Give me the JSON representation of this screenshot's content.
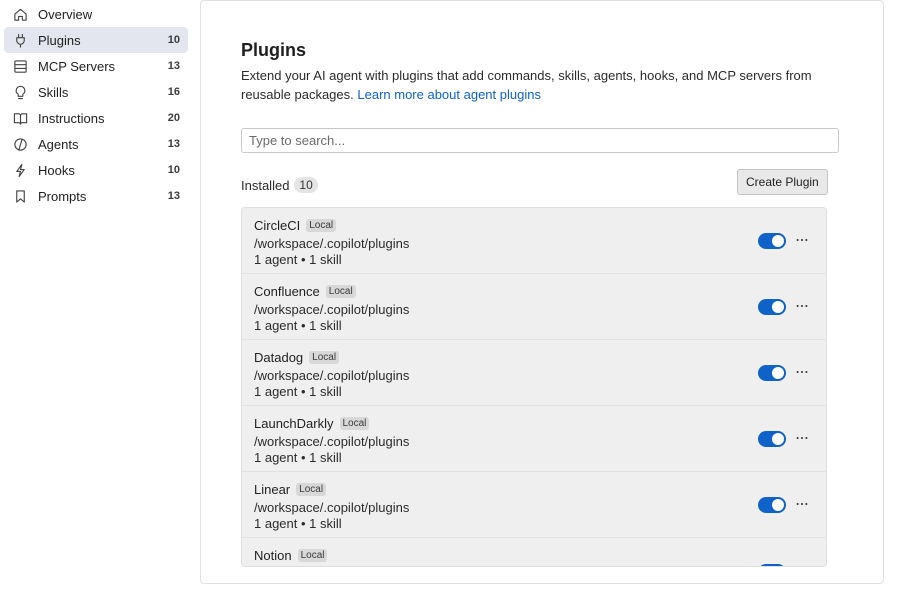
{
  "sidebar": {
    "items": [
      {
        "label": "Overview",
        "count": "",
        "icon": "home-icon"
      },
      {
        "label": "Plugins",
        "count": "10",
        "icon": "plug-icon",
        "active": true
      },
      {
        "label": "MCP Servers",
        "count": "13",
        "icon": "server-icon"
      },
      {
        "label": "Skills",
        "count": "16",
        "icon": "lightbulb-icon"
      },
      {
        "label": "Instructions",
        "count": "20",
        "icon": "book-icon"
      },
      {
        "label": "Agents",
        "count": "13",
        "icon": "agent-icon"
      },
      {
        "label": "Hooks",
        "count": "10",
        "icon": "lightning-icon"
      },
      {
        "label": "Prompts",
        "count": "13",
        "icon": "bookmark-icon"
      }
    ]
  },
  "main": {
    "title": "Plugins",
    "description": "Extend your AI agent with plugins that add commands, skills, agents, hooks, and MCP servers from reusable packages.",
    "learn_more": "Learn more about agent plugins",
    "search_placeholder": "Type to search...",
    "installed_label": "Installed",
    "installed_count": "10",
    "create_button": "Create Plugin",
    "plugins": [
      {
        "name": "CircleCI",
        "badge": "Local",
        "path": "/workspace/.copilot/plugins",
        "meta": "1 agent • 1 skill",
        "enabled": true
      },
      {
        "name": "Confluence",
        "badge": "Local",
        "path": "/workspace/.copilot/plugins",
        "meta": "1 agent • 1 skill",
        "enabled": true
      },
      {
        "name": "Datadog",
        "badge": "Local",
        "path": "/workspace/.copilot/plugins",
        "meta": "1 agent • 1 skill",
        "enabled": true
      },
      {
        "name": "LaunchDarkly",
        "badge": "Local",
        "path": "/workspace/.copilot/plugins",
        "meta": "1 agent • 1 skill",
        "enabled": true
      },
      {
        "name": "Linear",
        "badge": "Local",
        "path": "/workspace/.copilot/plugins",
        "meta": "1 agent • 1 skill",
        "enabled": true
      },
      {
        "name": "Notion",
        "badge": "Local",
        "path": "",
        "meta": "",
        "enabled": true
      }
    ]
  },
  "colors": {
    "accent": "#0f62c7",
    "active_nav": "#e3e6ef",
    "row_bg": "#efefef"
  }
}
